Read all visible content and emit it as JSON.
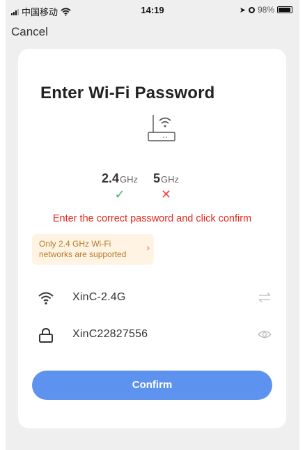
{
  "status_bar": {
    "carrier": "中国移动",
    "time": "14:19",
    "battery": "98%"
  },
  "nav": {
    "cancel_label": "Cancel"
  },
  "card": {
    "title": "Enter Wi-Fi Password",
    "bands": [
      {
        "value": "2.4",
        "unit": "GHz",
        "mark": "✓",
        "supported": true
      },
      {
        "value": "5",
        "unit": "GHz",
        "mark": "✕",
        "supported": false
      }
    ],
    "instruction": "Enter the correct password and click confirm",
    "notice": {
      "text": "Only 2.4 GHz Wi-Fi networks are supported",
      "arrow": "›"
    },
    "wifi_field": {
      "value": "XinC-2.4G",
      "icon": "wifi-icon",
      "action_icon": "switch-network-icon"
    },
    "password_field": {
      "value": "XinC22827556",
      "icon": "lock-icon",
      "action_icon": "eye-icon"
    },
    "confirm_label": "Confirm"
  },
  "colors": {
    "accent": "#5d93ee",
    "error": "#e8261b",
    "success": "#3dbb5b",
    "notice_bg": "#fff4e3",
    "notice_text": "#b77a28"
  }
}
